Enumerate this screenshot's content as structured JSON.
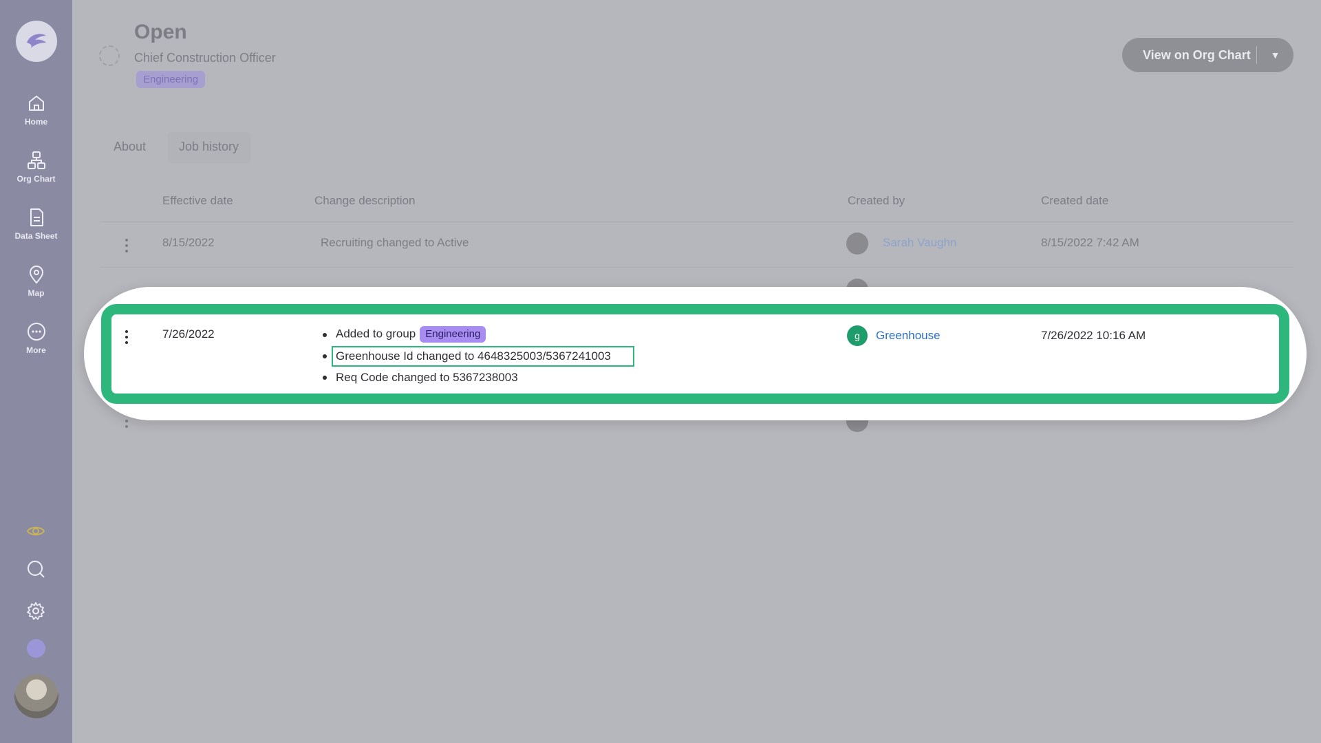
{
  "sidebar": {
    "nav": [
      {
        "label": "Home",
        "icon": "home-icon"
      },
      {
        "label": "Org Chart",
        "icon": "org-chart-icon"
      },
      {
        "label": "Data Sheet",
        "icon": "data-sheet-icon"
      },
      {
        "label": "Map",
        "icon": "map-pin-icon"
      },
      {
        "label": "More",
        "icon": "more-icon"
      }
    ],
    "bottom_icons": [
      "eye-icon",
      "search-icon",
      "gear-icon"
    ]
  },
  "header": {
    "title": "Open",
    "subtitle": "Chief Construction Officer",
    "tag": "Engineering",
    "org_chart_button": "View on Org Chart"
  },
  "tabs": [
    {
      "label": "About",
      "active": false
    },
    {
      "label": "Job history",
      "active": true
    }
  ],
  "table": {
    "columns": [
      "Effective date",
      "Change description",
      "Created by",
      "Created date"
    ],
    "rows": [
      {
        "effective_date": "8/15/2022",
        "description": "Recruiting changed to Active",
        "created_by": "Sarah Vaughn",
        "created_date": "8/15/2022 7:42 AM"
      },
      {
        "effective_date": "7/26/2022",
        "changes": [
          {
            "text": "Added to group",
            "tag": "Engineering"
          },
          {
            "text": "Greenhouse Id changed to 4648325003/5367241003"
          },
          {
            "text": "Req Code changed to 5367238003"
          }
        ],
        "created_by": "Greenhouse",
        "created_by_initial": "g",
        "created_date": "7/26/2022 10:16 AM"
      }
    ]
  },
  "colors": {
    "highlight": "#2eb77d",
    "tag_purple": "#a78df0",
    "link_blue": "#2e6fc6",
    "sidebar": "#8a8aa3"
  }
}
